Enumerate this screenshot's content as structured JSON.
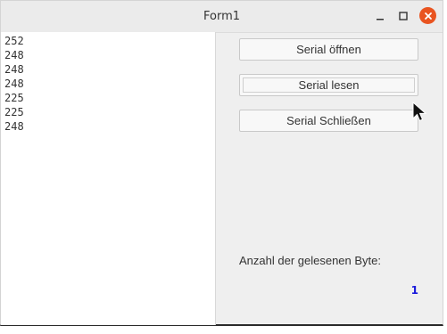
{
  "window": {
    "title": "Form1"
  },
  "memo": {
    "lines": [
      "252",
      "248",
      "248",
      "248",
      "225",
      "225",
      "248"
    ]
  },
  "buttons": {
    "open_label": "Serial öffnen",
    "read_label": "Serial lesen",
    "close_label": "Serial Schließen"
  },
  "byte_count": {
    "label": "Anzahl der gelesenen Byte:",
    "value": "1"
  },
  "colors": {
    "close_button": "#e95420",
    "count_value": "#1a1adc"
  },
  "icons": {
    "minimize": "minimize-icon",
    "maximize": "maximize-icon",
    "close": "close-icon",
    "cursor": "mouse-cursor-icon"
  }
}
